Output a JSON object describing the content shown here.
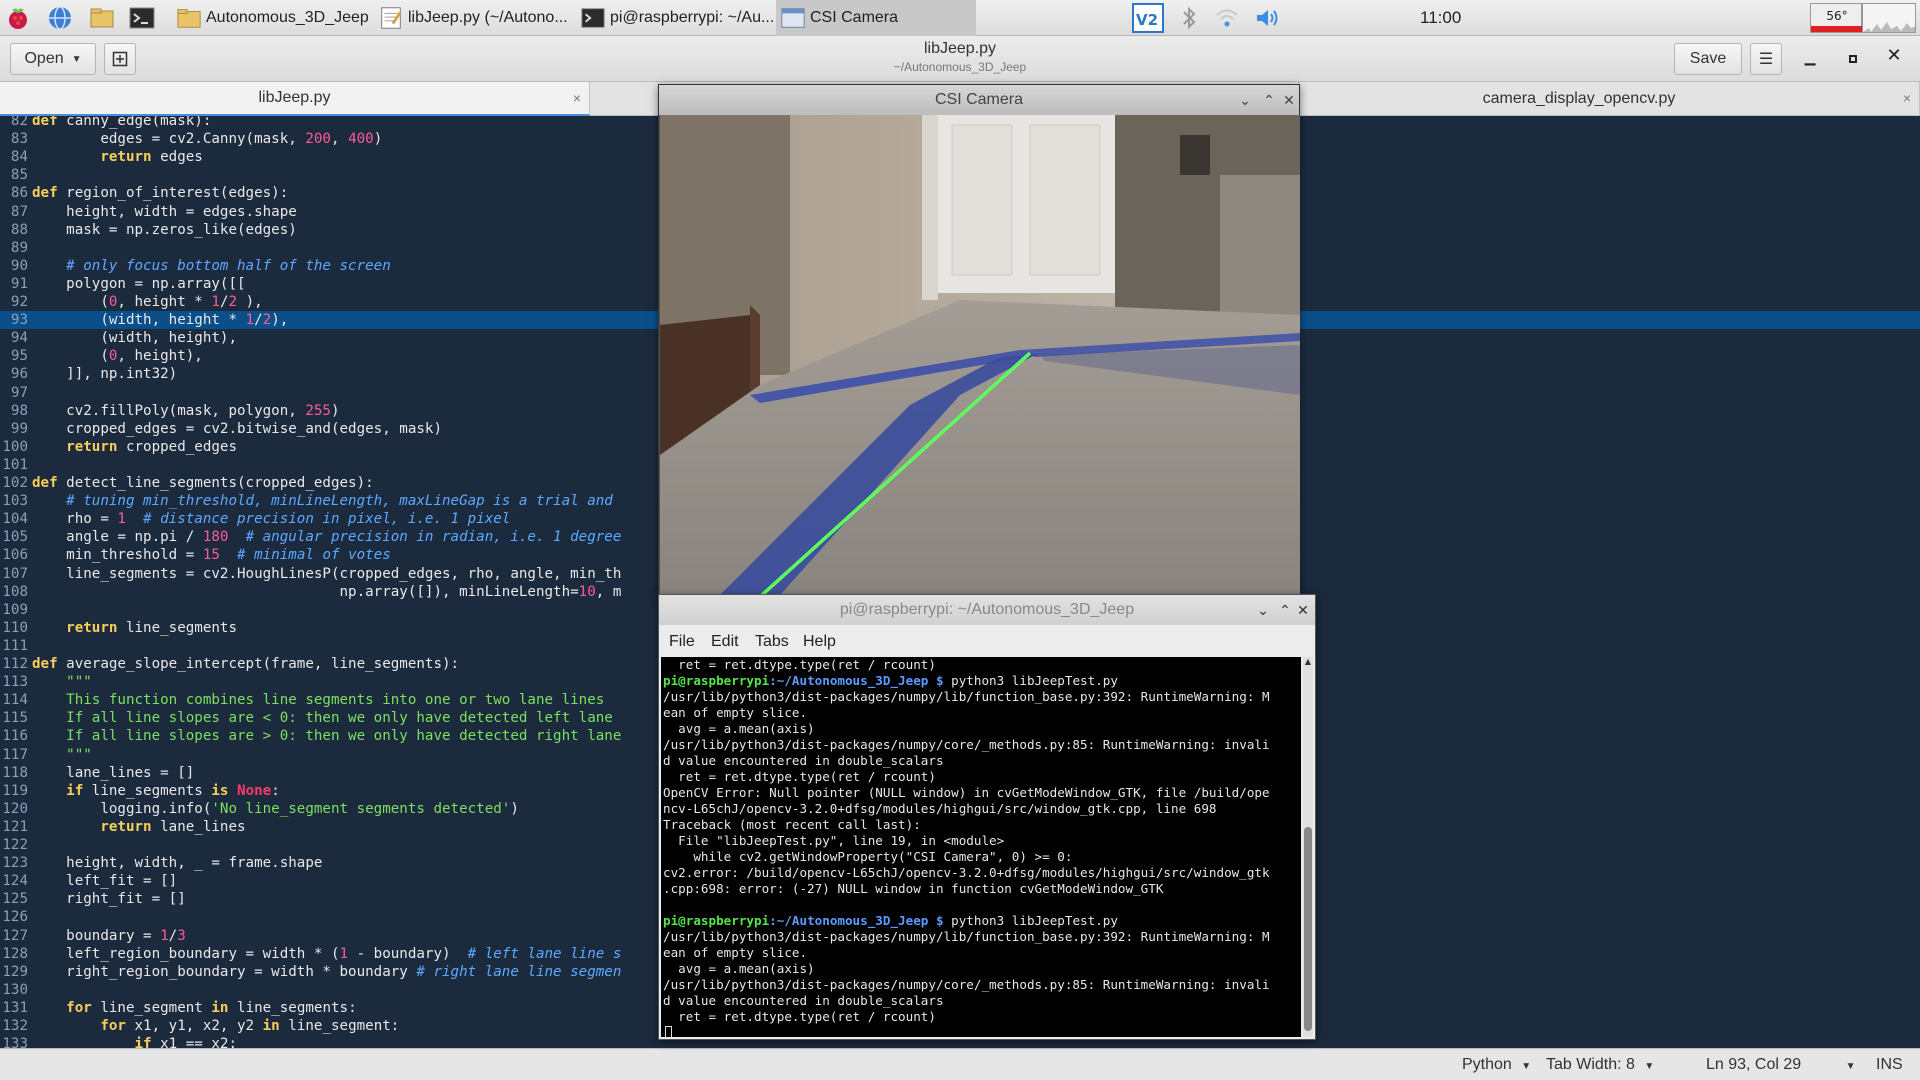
{
  "panel": {
    "tasks": [
      {
        "label": "Autonomous_3D_Jeep",
        "icon": "folder-icon"
      },
      {
        "label": "libJeep.py (~/Autono...",
        "icon": "text-editor-icon"
      },
      {
        "label": "pi@raspberrypi: ~/Au...",
        "icon": "terminal-icon"
      },
      {
        "label": "CSI Camera",
        "icon": "camera-window-icon"
      }
    ],
    "clock": "11:00",
    "cpu_temp": "56°",
    "colors": {
      "accent": "#4a90d9",
      "cpu_bar": "#e02020"
    }
  },
  "gedit": {
    "open_label": "Open",
    "title": "libJeep.py",
    "subtitle": "~/Autonomous_3D_Jeep",
    "save_label": "Save",
    "tabs": [
      {
        "label": "libJeep.py",
        "close": "×"
      },
      {
        "label": "camera_display_opencv.py",
        "close": "×"
      }
    ],
    "status": {
      "language": "Python",
      "tab_width": "Tab Width: 8",
      "position": "Ln 93, Col 29",
      "mode": "INS"
    }
  },
  "code": [
    {
      "n": "82",
      "html": "<span class='kw'>def</span> canny_edge(mask):"
    },
    {
      "n": "83",
      "html": "        edges = cv2.Canny(mask, <span class='n'>200</span>, <span class='n'>400</span>)"
    },
    {
      "n": "84",
      "html": "        <span class='kw'>return</span> edges"
    },
    {
      "n": "85",
      "html": ""
    },
    {
      "n": "86",
      "html": "<span class='kw'>def</span> region_of_interest(edges):"
    },
    {
      "n": "87",
      "html": "    height, width = edges.shape"
    },
    {
      "n": "88",
      "html": "    mask = np.zeros_like(edges)"
    },
    {
      "n": "89",
      "html": ""
    },
    {
      "n": "90",
      "html": "    <span class='cm'># only focus bottom half of the screen</span>"
    },
    {
      "n": "91",
      "html": "    polygon = np.array([["
    },
    {
      "n": "92",
      "html": "        (<span class='n'>0</span>, height * <span class='n'>1</span>/<span class='n'>2</span> ),"
    },
    {
      "n": "93",
      "html": "        (width, height * <span class='n'>1</span>/<span class='n'>2</span>),",
      "current": true
    },
    {
      "n": "94",
      "html": "        (width, height),"
    },
    {
      "n": "95",
      "html": "        (<span class='n'>0</span>, height),"
    },
    {
      "n": "96",
      "html": "    ]], np.int32)"
    },
    {
      "n": "97",
      "html": ""
    },
    {
      "n": "98",
      "html": "    cv2.fillPoly(mask, polygon, <span class='n'>255</span>)"
    },
    {
      "n": "99",
      "html": "    cropped_edges = cv2.bitwise_and(edges, mask)"
    },
    {
      "n": "100",
      "html": "    <span class='kw'>return</span> cropped_edges"
    },
    {
      "n": "101",
      "html": ""
    },
    {
      "n": "102",
      "html": "<span class='kw'>def</span> detect_line_segments(cropped_edges):"
    },
    {
      "n": "103",
      "html": "    <span class='cm'># tuning min_threshold, minLineLength, maxLineGap is a trial and</span>"
    },
    {
      "n": "104",
      "html": "    rho = <span class='n'>1</span>  <span class='cm'># distance precision in pixel, i.e. 1 pixel</span>"
    },
    {
      "n": "105",
      "html": "    angle = np.pi / <span class='n'>180</span>  <span class='cm'># angular precision in radian, i.e. 1 degree</span>"
    },
    {
      "n": "106",
      "html": "    min_threshold = <span class='n'>15</span>  <span class='cm'># minimal of votes</span>"
    },
    {
      "n": "107",
      "html": "    line_segments = cv2.HoughLinesP(cropped_edges, rho, angle, min_th"
    },
    {
      "n": "108",
      "html": "                                    np.array([]), minLineLength=<span class='n'>10</span>, m"
    },
    {
      "n": "109",
      "html": ""
    },
    {
      "n": "110",
      "html": "    <span class='kw'>return</span> line_segments"
    },
    {
      "n": "111",
      "html": ""
    },
    {
      "n": "112",
      "html": "<span class='kw'>def</span> average_slope_intercept(frame, line_segments):"
    },
    {
      "n": "113",
      "html": "    <span class='st'>\"\"\"</span>"
    },
    {
      "n": "114",
      "html": "<span class='st'>    This function combines line segments into one or two lane lines</span>"
    },
    {
      "n": "115",
      "html": "<span class='st'>    If all line slopes are &lt; 0: then we only have detected left lane</span>"
    },
    {
      "n": "116",
      "html": "<span class='st'>    If all line slopes are &gt; 0: then we only have detected right lane</span>"
    },
    {
      "n": "117",
      "html": "<span class='st'>    \"\"\"</span>"
    },
    {
      "n": "118",
      "html": "    lane_lines = []"
    },
    {
      "n": "119",
      "html": "    <span class='kw'>if</span> line_segments <span class='kw'>is</span> <span class='nn'>None</span>:"
    },
    {
      "n": "120",
      "html": "        logging.info(<span class='st'>'No line_segment segments detected'</span>)"
    },
    {
      "n": "121",
      "html": "        <span class='kw'>return</span> lane_lines"
    },
    {
      "n": "122",
      "html": ""
    },
    {
      "n": "123",
      "html": "    height, width, _ = frame.shape"
    },
    {
      "n": "124",
      "html": "    left_fit = []"
    },
    {
      "n": "125",
      "html": "    right_fit = []"
    },
    {
      "n": "126",
      "html": ""
    },
    {
      "n": "127",
      "html": "    boundary = <span class='n'>1</span>/<span class='n'>3</span>"
    },
    {
      "n": "128",
      "html": "    left_region_boundary = width * (<span class='n'>1</span> - boundary)  <span class='cm'># left lane line s</span>"
    },
    {
      "n": "129",
      "html": "    right_region_boundary = width * boundary <span class='cm'># right lane line segmen</span>"
    },
    {
      "n": "130",
      "html": ""
    },
    {
      "n": "131",
      "html": "    <span class='kw'>for</span> line_segment <span class='kw'>in</span> line_segments:"
    },
    {
      "n": "132",
      "html": "        <span class='kw'>for</span> x1, y1, x2, y2 <span class='kw'>in</span> line_segment:"
    },
    {
      "n": "133",
      "html": "            <span class='kw'>if</span> x1 == x2:"
    }
  ],
  "camera": {
    "title": "CSI Camera"
  },
  "terminal": {
    "title": "pi@raspberrypi: ~/Autonomous_3D_Jeep",
    "menu": [
      "File",
      "Edit",
      "Tabs",
      "Help"
    ],
    "lines": [
      {
        "t": "  ret = ret.dtype.type(ret / rcount)"
      },
      {
        "prompt": "pi@raspberrypi",
        "path": ":~/Autonomous_3D_Jeep $",
        "cmd": " python3 libJeepTest.py"
      },
      {
        "t": "/usr/lib/python3/dist-packages/numpy/lib/function_base.py:392: RuntimeWarning: M"
      },
      {
        "t": "ean of empty slice."
      },
      {
        "t": "  avg = a.mean(axis)"
      },
      {
        "t": "/usr/lib/python3/dist-packages/numpy/core/_methods.py:85: RuntimeWarning: invali"
      },
      {
        "t": "d value encountered in double_scalars"
      },
      {
        "t": "  ret = ret.dtype.type(ret / rcount)"
      },
      {
        "t": "OpenCV Error: Null pointer (NULL window) in cvGetModeWindow_GTK, file /build/ope"
      },
      {
        "t": "ncv-L65chJ/opencv-3.2.0+dfsg/modules/highgui/src/window_gtk.cpp, line 698"
      },
      {
        "t": "Traceback (most recent call last):"
      },
      {
        "t": "  File \"libJeepTest.py\", line 19, in <module>"
      },
      {
        "t": "    while cv2.getWindowProperty(\"CSI Camera\", 0) >= 0:"
      },
      {
        "t": "cv2.error: /build/opencv-L65chJ/opencv-3.2.0+dfsg/modules/highgui/src/window_gtk"
      },
      {
        "t": ".cpp:698: error: (-27) NULL window in function cvGetModeWindow_GTK"
      },
      {
        "t": ""
      },
      {
        "prompt": "pi@raspberrypi",
        "path": ":~/Autonomous_3D_Jeep $",
        "cmd": " python3 libJeepTest.py"
      },
      {
        "t": "/usr/lib/python3/dist-packages/numpy/lib/function_base.py:392: RuntimeWarning: M"
      },
      {
        "t": "ean of empty slice."
      },
      {
        "t": "  avg = a.mean(axis)"
      },
      {
        "t": "/usr/lib/python3/dist-packages/numpy/core/_methods.py:85: RuntimeWarning: invali"
      },
      {
        "t": "d value encountered in double_scalars"
      },
      {
        "t": "  ret = ret.dtype.type(ret / rcount)"
      },
      {
        "t": ""
      }
    ]
  }
}
